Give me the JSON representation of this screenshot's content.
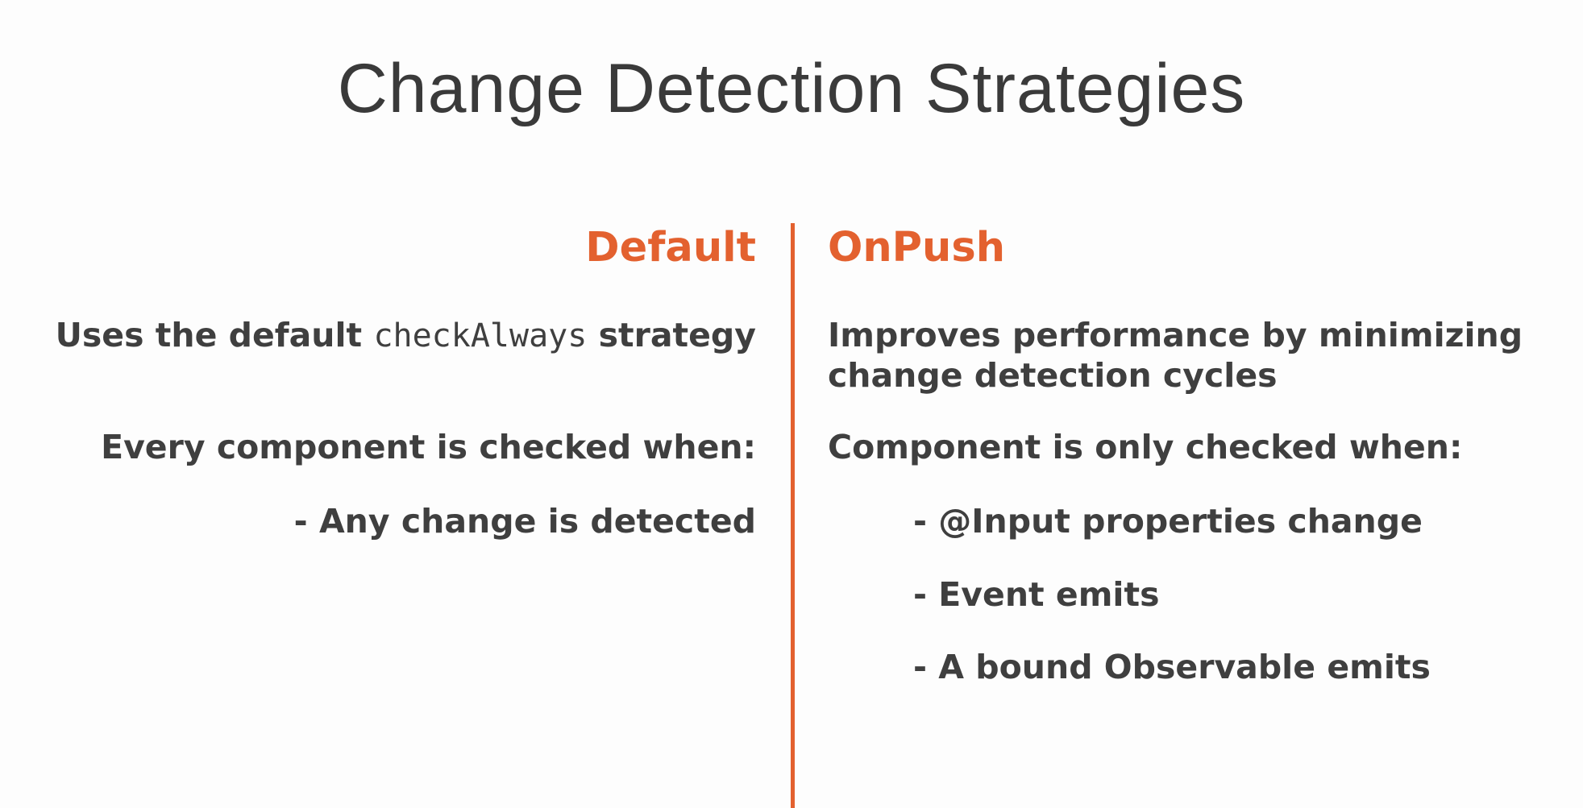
{
  "slide": {
    "title": "Change Detection Strategies",
    "accent_color": "#e3612f",
    "text_color": "#3f3f3f"
  },
  "left": {
    "heading": "Default",
    "desc_prefix": "Uses the default",
    "desc_code": "checkAlways",
    "desc_suffix": "strategy",
    "checked_when": "Every component is checked when:",
    "bullets": [
      "- Any change is detected"
    ]
  },
  "right": {
    "heading": "OnPush",
    "desc_line1": "Improves performance by minimizing",
    "desc_line2": "change detection cycles",
    "checked_when": "Component is only checked when:",
    "bullets": [
      "- @Input properties change",
      "- Event emits",
      "- A bound Observable emits"
    ]
  }
}
